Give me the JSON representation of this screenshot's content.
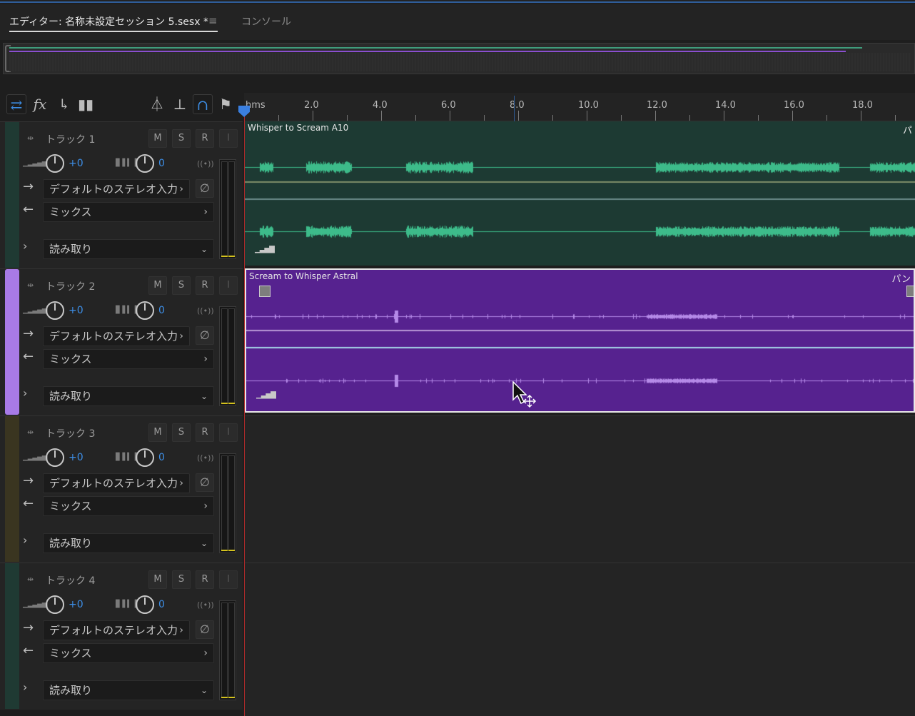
{
  "tabs": {
    "editor_label": "エディター: 名称未設定セッション 5.sesx *",
    "menu_icon": "≡",
    "console_label": "コンソール"
  },
  "toolbar": {
    "icons": [
      "swap-icon",
      "fx-icon",
      "send-icon",
      "eq-icon",
      "metronome-icon",
      "punch-icon",
      "snap-icon",
      "marker-icon"
    ]
  },
  "ruler": {
    "labels": [
      "hms",
      "2.0",
      "4.0",
      "6.0",
      "8.0",
      "10.0",
      "12.0",
      "14.0",
      "16.0",
      "18.0"
    ]
  },
  "tracks": [
    {
      "name": "トラック 1",
      "m": "M",
      "s": "S",
      "r": "R",
      "i": "I",
      "volume": "+0",
      "pan": "0",
      "input": "デフォルトのステレオ入力",
      "output": "ミックス",
      "automation": "読み取り",
      "color": "#1f3a33"
    },
    {
      "name": "トラック 2",
      "m": "M",
      "s": "S",
      "r": "R",
      "i": "I",
      "volume": "+0",
      "pan": "0",
      "input": "デフォルトのステレオ入力",
      "output": "ミックス",
      "automation": "読み取り",
      "color": "#a87ae6"
    },
    {
      "name": "トラック 3",
      "m": "M",
      "s": "S",
      "r": "R",
      "i": "I",
      "volume": "+0",
      "pan": "0",
      "input": "デフォルトのステレオ入力",
      "output": "ミックス",
      "automation": "読み取り",
      "color": "#3a3520"
    },
    {
      "name": "トラック 4",
      "m": "M",
      "s": "S",
      "r": "R",
      "i": "I",
      "volume": "+0",
      "pan": "0",
      "input": "デフォルトのステレオ入力",
      "output": "ミックス",
      "automation": "読み取り",
      "color": "#1f3a33"
    }
  ],
  "clips": [
    {
      "title": "Whisper to Scream A10",
      "right_label": "パ",
      "color": "#1d3a33",
      "wave_color": "#3dbb8a"
    },
    {
      "title": "Scream to Whisper Astral",
      "right_label": "パン",
      "color": "#56228f",
      "wave_color": "#b58ae8"
    }
  ],
  "colors": {
    "accent": "#3d8ee6",
    "playhead": "#b02a2a"
  }
}
